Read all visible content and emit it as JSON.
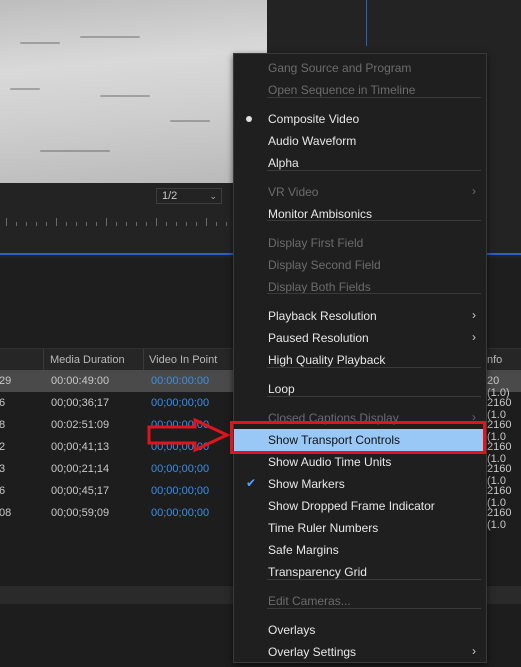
{
  "monitor": {
    "resolution_selector": "1/2",
    "colors": {
      "panel_bg": "#232323",
      "accent_blue": "#2d5fc8"
    }
  },
  "table": {
    "headers": [
      "Media Duration",
      "Video In Point",
      "nfo"
    ],
    "rows": [
      {
        "left": "29",
        "duration": "00:00:49:00",
        "in_point": "00:00:00:00",
        "info": "20 (1.0)"
      },
      {
        "left": "6",
        "duration": "00;00;36;17",
        "in_point": "00;00;00;00",
        "info": "2160 (1.0"
      },
      {
        "left": "8",
        "duration": "00:02:51:09",
        "in_point": "00:00:00:00",
        "info": "2160 (1.0"
      },
      {
        "left": "2",
        "duration": "00;00;41;13",
        "in_point": "00;00;00;00",
        "info": "2160 (1.0"
      },
      {
        "left": "3",
        "duration": "00;00;21;14",
        "in_point": "00;00;00;00",
        "info": "2160 (1.0"
      },
      {
        "left": "6",
        "duration": "00;00;45;17",
        "in_point": "00;00;00;00",
        "info": "2160 (1.0"
      },
      {
        "left": "08",
        "duration": "00;00;59;09",
        "in_point": "00;00;00;00",
        "info": "2160 (1.0"
      }
    ]
  },
  "menu": {
    "items": [
      {
        "label": "Gang Source and Program",
        "disabled": true
      },
      {
        "label": "Open Sequence in Timeline",
        "disabled": true
      },
      {
        "label": "Composite Video",
        "mark": "dot"
      },
      {
        "label": "Audio Waveform"
      },
      {
        "label": "Alpha"
      },
      {
        "label": "VR Video",
        "disabled": true,
        "submenu": true
      },
      {
        "label": "Monitor Ambisonics"
      },
      {
        "label": "Display First Field",
        "disabled": true
      },
      {
        "label": "Display Second Field",
        "disabled": true
      },
      {
        "label": "Display Both Fields",
        "disabled": true
      },
      {
        "label": "Playback Resolution",
        "submenu": true
      },
      {
        "label": "Paused Resolution",
        "submenu": true
      },
      {
        "label": "High Quality Playback"
      },
      {
        "label": "Loop"
      },
      {
        "label": "Closed Captions Display",
        "disabled": true,
        "submenu": true
      },
      {
        "label": "Show Transport Controls",
        "highlighted": true
      },
      {
        "label": "Show Audio Time Units"
      },
      {
        "label": "Show Markers",
        "mark": "check"
      },
      {
        "label": "Show Dropped Frame Indicator"
      },
      {
        "label": "Time Ruler Numbers"
      },
      {
        "label": "Safe Margins"
      },
      {
        "label": "Transparency Grid"
      },
      {
        "label": "Edit Cameras...",
        "disabled": true
      },
      {
        "label": "Overlays"
      },
      {
        "label": "Overlay Settings",
        "submenu": true
      }
    ],
    "submenu_glyph": "›",
    "check_glyph": "✔",
    "highlight_color": "#99c8f7",
    "annotation_color": "#e1131c"
  }
}
